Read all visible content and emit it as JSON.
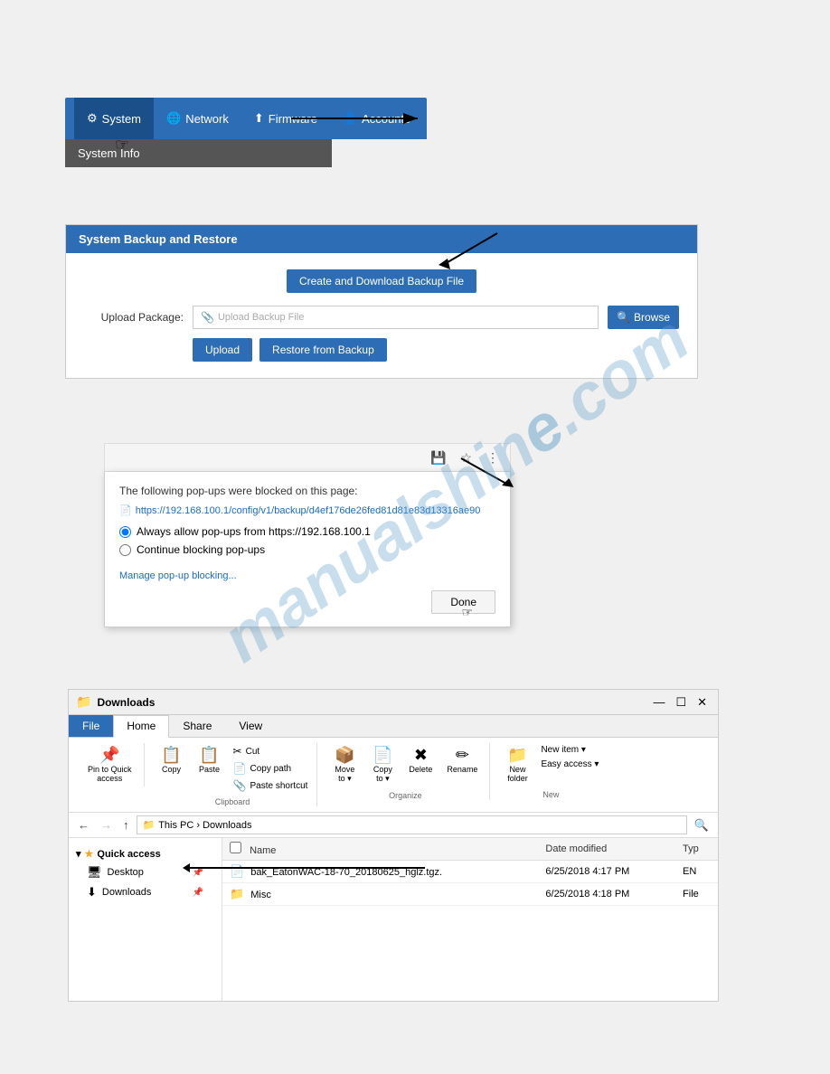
{
  "nav": {
    "items": [
      {
        "id": "system",
        "label": "System",
        "icon": "⚙",
        "active": true
      },
      {
        "id": "network",
        "label": "Network",
        "icon": "🌐",
        "active": false
      },
      {
        "id": "firmware",
        "label": "Firmware",
        "icon": "⬆",
        "active": false
      },
      {
        "id": "accounts",
        "label": "Accounts",
        "icon": "👤",
        "active": false
      }
    ]
  },
  "system_info": {
    "label": "System Info"
  },
  "backup_section": {
    "title": "System Backup and Restore",
    "create_btn": "Create and Download Backup File",
    "upload_label": "Upload Package:",
    "upload_placeholder": "Upload Backup File",
    "browse_btn": "Browse",
    "upload_btn": "Upload",
    "restore_btn": "Restore from Backup"
  },
  "popup": {
    "title": "The following pop-ups were blocked on this page:",
    "link": "https://192.168.100.1/config/v1/backup/d4ef176de26fed81d81e83d13316ae90",
    "option1": "Always allow pop-ups from https://192.168.100.1",
    "option2": "Continue blocking pop-ups",
    "manage_link": "Manage pop-up blocking...",
    "done_btn": "Done"
  },
  "explorer": {
    "title": "Downloads",
    "tabs": [
      "File",
      "Home",
      "Share",
      "View"
    ],
    "active_tab": "Home",
    "ribbon": {
      "pin_to_access": "Pin to Quick\naccess",
      "copy": "Copy",
      "paste": "Paste",
      "cut": "Cut",
      "copy_path": "Copy path",
      "paste_shortcut": "Paste shortcut",
      "move_to": "Move\nto ▾",
      "copy_to": "Copy\nto ▾",
      "delete": "Delete",
      "rename": "Rename",
      "new_folder": "New\nfolder",
      "new_item": "New item ▾",
      "easy_access": "Easy access ▾",
      "group_clipboard": "Clipboard",
      "group_organize": "Organize",
      "group_new": "New"
    },
    "address": {
      "path": "This PC › Downloads"
    },
    "columns": [
      "Name",
      "Date modified",
      "Typ"
    ],
    "sidebar": {
      "quick_access_label": "Quick access",
      "items": [
        {
          "name": "Desktop",
          "icon": "🖥",
          "pin": true
        },
        {
          "name": "Downloads",
          "icon": "⬇",
          "pin": true
        }
      ]
    },
    "files": [
      {
        "icon": "📄",
        "name": "bak_EatonWAC-18-70_20180625_hglz.tgz.",
        "modified": "6/25/2018 4:17 PM",
        "type": "EN"
      },
      {
        "icon": "📁",
        "name": "Misc",
        "modified": "6/25/2018 4:18 PM",
        "type": "File"
      }
    ]
  },
  "watermark": "manualshin e.com"
}
